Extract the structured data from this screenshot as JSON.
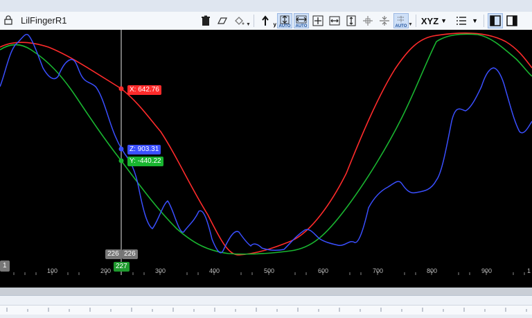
{
  "window": {
    "title": "LilFingerR1"
  },
  "toolbar": {
    "auto_label": "AUTO",
    "xyz_label": "XYZ",
    "y_label": "y"
  },
  "readouts": {
    "x": "X: 642.76",
    "z": "Z: 903.31",
    "y": "Y: -440.22"
  },
  "cursor": {
    "left_label": "226",
    "right_label": "226",
    "frame_label": "227"
  },
  "axis": {
    "ticks": [
      "100",
      "200",
      "300",
      "400",
      "500",
      "600",
      "700",
      "800",
      "900",
      "1"
    ],
    "badge": "1"
  },
  "colors": {
    "x": "#ff2b2b",
    "y": "#19b530",
    "z": "#3a4fff",
    "cursor": "#9a9a9a"
  }
}
